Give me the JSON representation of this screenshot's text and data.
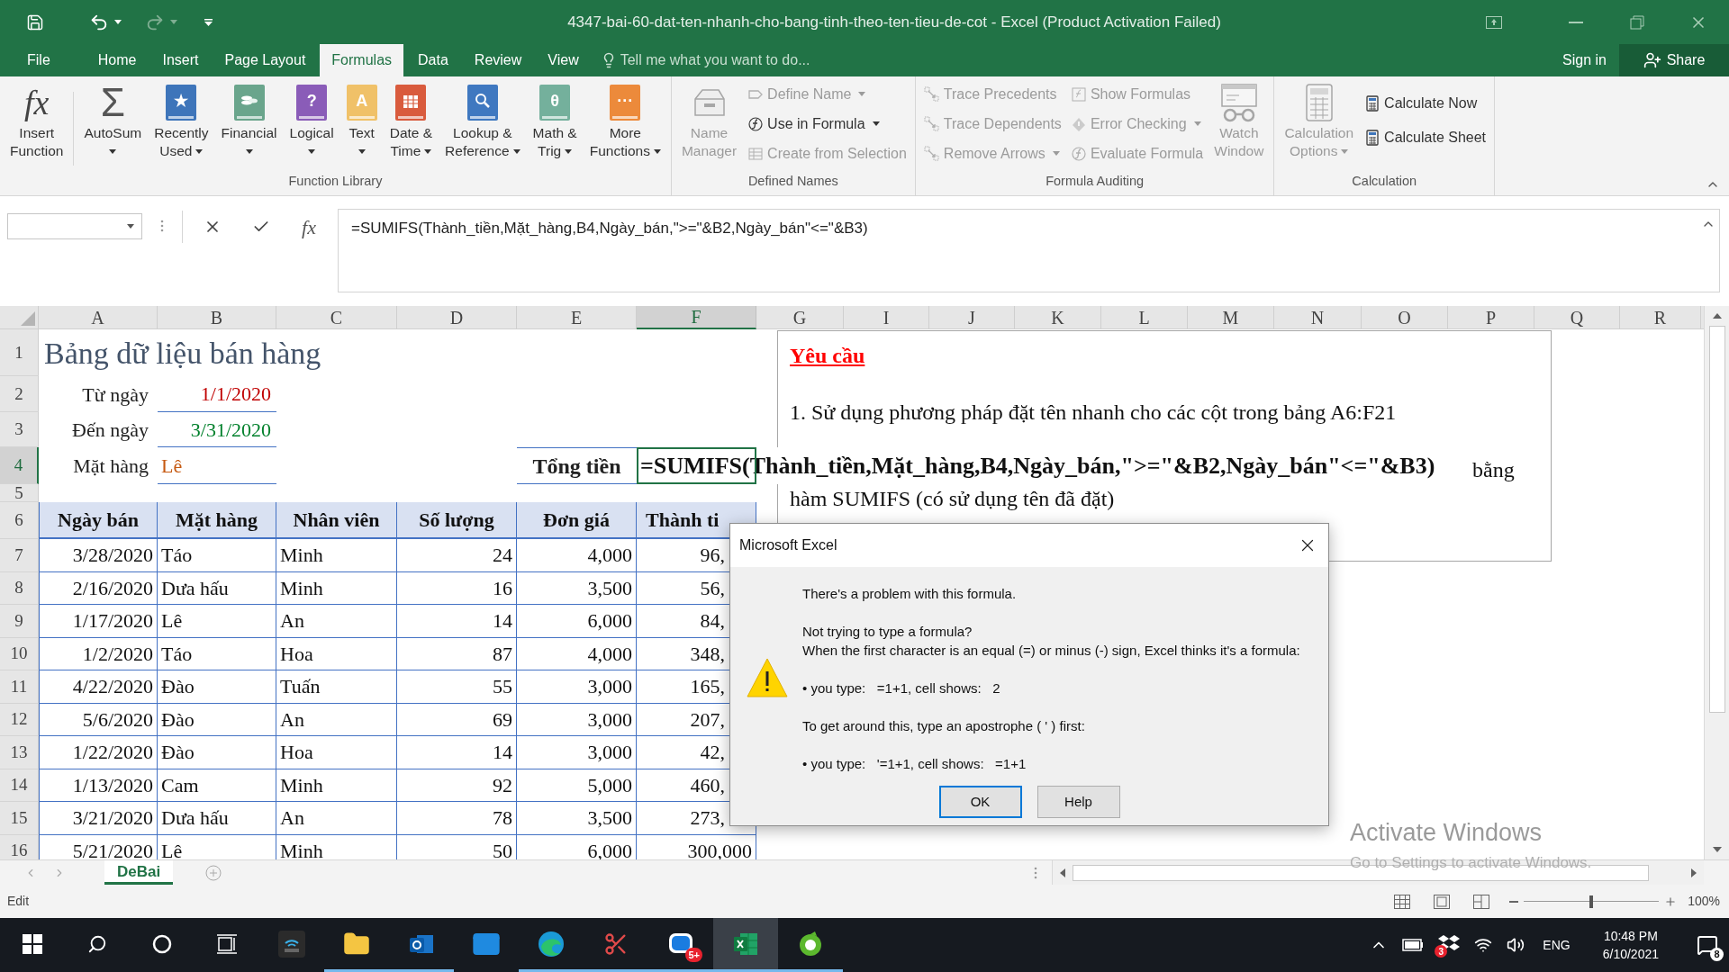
{
  "window": {
    "title": "4347-bai-60-dat-ten-nhanh-cho-bang-tinh-theo-ten-tieu-de-cot - Excel (Product Activation Failed)"
  },
  "quick_access": [
    {
      "kind": "save",
      "disabled": false
    },
    {
      "kind": "undo",
      "disabled": false
    },
    {
      "kind": "redo",
      "disabled": true
    },
    {
      "kind": "customize",
      "disabled": false
    }
  ],
  "menu_tabs": [
    {
      "label": "File",
      "selected": false
    },
    {
      "label": "Home",
      "selected": false
    },
    {
      "label": "Insert",
      "selected": false
    },
    {
      "label": "Page Layout",
      "selected": false
    },
    {
      "label": "Formulas",
      "selected": true
    },
    {
      "label": "Data",
      "selected": false
    },
    {
      "label": "Review",
      "selected": false
    },
    {
      "label": "View",
      "selected": false
    }
  ],
  "tell_me": {
    "placeholder": "Tell me what you want to do..."
  },
  "account": {
    "sign_in": "Sign in",
    "share": "Share"
  },
  "ribbon": {
    "groups": [
      {
        "label": "Function Library",
        "items": [
          {
            "kind": "large",
            "lines": [
              "Insert",
              "Function"
            ],
            "glyph": "fx",
            "dropdown": false,
            "disabled": false
          },
          {
            "kind": "large",
            "lines": [
              "AutoSum"
            ],
            "glyph": "Σ",
            "dropdown": true,
            "disabled": false
          },
          {
            "kind": "large",
            "lines": [
              "Recently",
              "Used"
            ],
            "glyph": "★",
            "dropdown": true,
            "disabled": false
          },
          {
            "kind": "large",
            "lines": [
              "Financial"
            ],
            "dropdown": true,
            "disabled": false
          },
          {
            "kind": "large",
            "lines": [
              "Logical"
            ],
            "glyph": "?",
            "dropdown": true,
            "disabled": false
          },
          {
            "kind": "large",
            "lines": [
              "Text"
            ],
            "glyph": "A",
            "dropdown": true,
            "disabled": false
          },
          {
            "kind": "large",
            "lines": [
              "Date &",
              "Time"
            ],
            "dropdown": true,
            "disabled": false
          },
          {
            "kind": "large",
            "lines": [
              "Lookup &",
              "Reference"
            ],
            "dropdown": true,
            "disabled": false
          },
          {
            "kind": "large",
            "lines": [
              "Math &",
              "Trig"
            ],
            "glyph": "θ",
            "dropdown": true,
            "disabled": false
          },
          {
            "kind": "large",
            "lines": [
              "More",
              "Functions"
            ],
            "glyph": "···",
            "dropdown": true,
            "disabled": false
          }
        ]
      },
      {
        "label": "Defined Names",
        "items": [
          {
            "kind": "large",
            "lines": [
              "Name",
              "Manager"
            ],
            "dropdown": false,
            "disabled": true
          },
          {
            "kind": "small",
            "lines": [
              "Define Name"
            ],
            "dropdown": true,
            "disabled": true
          },
          {
            "kind": "small",
            "lines": [
              "Use in Formula"
            ],
            "dropdown": true,
            "disabled": false
          },
          {
            "kind": "small",
            "lines": [
              "Create from Selection"
            ],
            "dropdown": false,
            "disabled": true
          }
        ]
      },
      {
        "label": "Formula Auditing",
        "items": [
          {
            "kind": "small",
            "lines": [
              "Trace Precedents"
            ],
            "dropdown": false,
            "disabled": true
          },
          {
            "kind": "small",
            "lines": [
              "Trace Dependents"
            ],
            "dropdown": false,
            "disabled": true
          },
          {
            "kind": "small",
            "lines": [
              "Remove Arrows"
            ],
            "dropdown": true,
            "disabled": true
          },
          {
            "kind": "small",
            "lines": [
              "Show Formulas"
            ],
            "dropdown": false,
            "disabled": true
          },
          {
            "kind": "small",
            "lines": [
              "Error Checking"
            ],
            "dropdown": true,
            "disabled": true
          },
          {
            "kind": "small",
            "lines": [
              "Evaluate Formula"
            ],
            "dropdown": false,
            "disabled": true
          },
          {
            "kind": "large",
            "lines": [
              "Watch",
              "Window"
            ],
            "dropdown": false,
            "disabled": true
          }
        ]
      },
      {
        "label": "Calculation",
        "items": [
          {
            "kind": "large",
            "lines": [
              "Calculation",
              "Options"
            ],
            "dropdown": true,
            "disabled": true
          },
          {
            "kind": "small",
            "lines": [
              "Calculate Now"
            ],
            "dropdown": false,
            "disabled": false
          },
          {
            "kind": "small",
            "lines": [
              "Calculate Sheet"
            ],
            "dropdown": false,
            "disabled": false
          }
        ]
      }
    ]
  },
  "formula_bar": {
    "function_glyph": "fx",
    "formula": "=SUMIFS(Thành_tiền,Mặt_hàng,B4,Ngày_bán,\">=\"&B2,Ngày_bán\"<=\"&B3)"
  },
  "sheet": {
    "columns": [
      {
        "label": "A",
        "selected": false
      },
      {
        "label": "B",
        "selected": false
      },
      {
        "label": "C",
        "selected": false
      },
      {
        "label": "D",
        "selected": false
      },
      {
        "label": "E",
        "selected": false
      },
      {
        "label": "F",
        "selected": true
      },
      {
        "label": "G",
        "selected": false
      },
      {
        "label": "I",
        "selected": false
      },
      {
        "label": "J",
        "selected": false
      },
      {
        "label": "K",
        "selected": false
      },
      {
        "label": "L",
        "selected": false
      },
      {
        "label": "M",
        "selected": false
      },
      {
        "label": "N",
        "selected": false
      },
      {
        "label": "O",
        "selected": false
      },
      {
        "label": "P",
        "selected": false
      },
      {
        "label": "Q",
        "selected": false
      },
      {
        "label": "R",
        "selected": false
      }
    ],
    "rows": [
      {
        "label": "1",
        "selected": false
      },
      {
        "label": "2",
        "selected": false
      },
      {
        "label": "3",
        "selected": false
      },
      {
        "label": "4",
        "selected": true
      },
      {
        "label": "5",
        "selected": false
      },
      {
        "label": "6",
        "selected": false
      },
      {
        "label": "7",
        "selected": false
      },
      {
        "label": "8",
        "selected": false
      },
      {
        "label": "9",
        "selected": false
      },
      {
        "label": "10",
        "selected": false
      },
      {
        "label": "11",
        "selected": false
      },
      {
        "label": "12",
        "selected": false
      },
      {
        "label": "13",
        "selected": false
      },
      {
        "label": "14",
        "selected": false
      },
      {
        "label": "15",
        "selected": false
      },
      {
        "label": "16",
        "selected": false
      }
    ],
    "title": "Bảng dữ liệu bán hàng",
    "criteria": [
      {
        "label": "Từ ngày",
        "value": "1/1/2020",
        "kind": "date",
        "color": "#c00000"
      },
      {
        "label": "Đến ngày",
        "value": "3/31/2020",
        "kind": "date",
        "color": "#00802b"
      },
      {
        "label": "Mặt hàng",
        "value": "Lê",
        "kind": "text",
        "color": "#c65911"
      }
    ],
    "total": {
      "label": "Tổng tiền",
      "value": "=SUMIFS(Thành_tiền,Mặt_hàng,B4,Ngày_bán,\">=\"&B2,Ngày_bán\"<=\"&B3)"
    },
    "table": {
      "columns": [
        "Ngày bán",
        "Mặt hàng",
        "Nhân viên",
        "Số lượng",
        "Đơn giá",
        "Thành ti"
      ],
      "rows": [
        [
          "3/28/2020",
          "Táo",
          "Minh",
          "24",
          "4,000",
          "96,"
        ],
        [
          "2/16/2020",
          "Dưa hấu",
          "Minh",
          "16",
          "3,500",
          "56,"
        ],
        [
          "1/17/2020",
          "Lê",
          "An",
          "14",
          "6,000",
          "84,"
        ],
        [
          "1/2/2020",
          "Táo",
          "Hoa",
          "87",
          "4,000",
          "348,"
        ],
        [
          "4/22/2020",
          "Đào",
          "Tuấn",
          "55",
          "3,000",
          "165,"
        ],
        [
          "5/6/2020",
          "Đào",
          "An",
          "69",
          "3,000",
          "207,"
        ],
        [
          "1/22/2020",
          "Đào",
          "Hoa",
          "14",
          "3,000",
          "42,"
        ],
        [
          "1/13/2020",
          "Cam",
          "Minh",
          "92",
          "5,000",
          "460,"
        ],
        [
          "3/21/2020",
          "Dưa hấu",
          "An",
          "78",
          "3,500",
          "273,"
        ],
        [
          "5/21/2020",
          "Lê",
          "Minh",
          "50",
          "6,000",
          "300,000"
        ]
      ]
    },
    "text_box": {
      "heading": "Yêu cầu",
      "lines": [
        "1. Sử dụng phương pháp đặt tên nhanh cho các cột trong bảng A6:F21",
        "bằng",
        "hàm SUMIFS (có sử dụng tên đã đặt)"
      ]
    }
  },
  "dialog": {
    "title": "Microsoft Excel",
    "paragraphs": [
      [
        "There's a problem with this formula."
      ],
      [
        "Not trying to type a formula?",
        "When the first character is an equal (=) or minus (-) sign, Excel thinks it's a formula:"
      ],
      [
        "• you type:   =1+1, cell shows:   2"
      ],
      [
        "To get around this, type an apostrophe ( ' ) first:"
      ],
      [
        "• you type:   '=1+1, cell shows:   =1+1"
      ]
    ],
    "buttons": [
      {
        "label": "OK",
        "selected": true
      },
      {
        "label": "Help",
        "selected": false
      }
    ]
  },
  "sheet_tabs": [
    {
      "label": "DeBai",
      "selected": true
    }
  ],
  "status_bar": {
    "mode": "Edit",
    "zoom": {
      "label": "100%",
      "level": 0.5
    }
  },
  "activation_notice": {
    "title": "Activate Windows",
    "text": "Go to Settings to activate Windows."
  },
  "taskbar": {
    "items": [
      {
        "kind": "start",
        "running": false,
        "selected": false
      },
      {
        "kind": "search",
        "running": false,
        "selected": false
      },
      {
        "kind": "cortana",
        "running": false,
        "selected": false
      },
      {
        "kind": "task_view",
        "running": false,
        "selected": false
      },
      {
        "kind": "phone_app",
        "running": false,
        "selected": false
      },
      {
        "kind": "explorer",
        "running": true,
        "selected": false
      },
      {
        "kind": "outlook",
        "running": true,
        "selected": false
      },
      {
        "kind": "mail",
        "running": false,
        "selected": false
      },
      {
        "kind": "edge",
        "running": true,
        "selected": false
      },
      {
        "kind": "snip",
        "running": true,
        "selected": false
      },
      {
        "kind": "chat",
        "running": true,
        "selected": false,
        "badge": "5+"
      },
      {
        "kind": "excel",
        "running": true,
        "selected": true
      },
      {
        "kind": "green_app",
        "running": true,
        "selected": false
      }
    ],
    "tray": {
      "dropbox_badge": "3",
      "language": "ENG",
      "time": "10:48 PM",
      "date": "6/10/2021",
      "notifications": "8"
    }
  }
}
